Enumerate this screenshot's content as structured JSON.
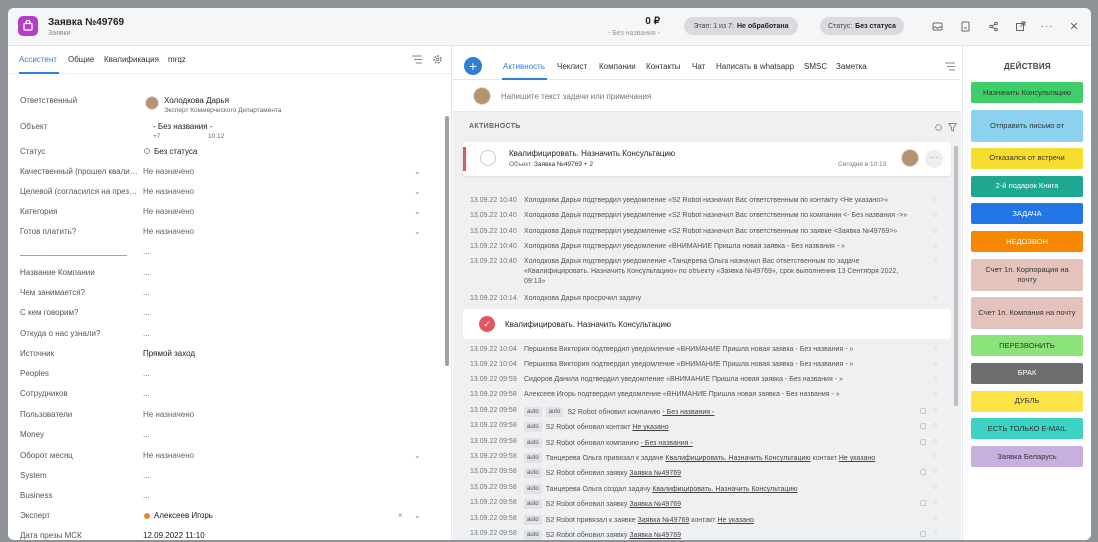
{
  "header": {
    "title": "Заявка  №49769",
    "subtitle": "Заявки",
    "amount": "0 ₽",
    "amount_sub": "- Без названия -",
    "stage_label": "Этап: 1 из 7:",
    "stage_value": "Не обработана",
    "status_label": "Статус:",
    "status_value": "Без статуса"
  },
  "left_tabs": [
    "Ассистент",
    "Общие",
    "Квалификация",
    "mrqz"
  ],
  "fields": [
    {
      "label": "Ответственный",
      "value": "Холодкова Дарья",
      "sub": "Эксперт Коммерческого Департамента"
    },
    {
      "label": "Объект",
      "value": "- Без названия -",
      "sub": "+7",
      "sub2": "10:12"
    },
    {
      "label": "Статус",
      "value": "Без статуса"
    },
    {
      "label": "Качественный (прошел квалификацию)",
      "value": "Не назначено"
    },
    {
      "label": "Целевой (согласился на презентацию)",
      "value": "Не назначено"
    },
    {
      "label": "Категория",
      "value": "Не назначено"
    },
    {
      "label": "Готов платить?",
      "value": "Не назначено"
    },
    {
      "label": "________________________",
      "value": "..."
    },
    {
      "label": "Название Компании",
      "value": "..."
    },
    {
      "label": "Чем занимается?",
      "value": "..."
    },
    {
      "label": "С кем говорим?",
      "value": "..."
    },
    {
      "label": "Откуда о нас узнали?",
      "value": "..."
    },
    {
      "label": "Источник",
      "value": "Прямой заход"
    },
    {
      "label": "Peoples",
      "value": "..."
    },
    {
      "label": "Сотрудников",
      "value": "..."
    },
    {
      "label": "Пользователи",
      "value": "Не назначено"
    },
    {
      "label": "Money",
      "value": "..."
    },
    {
      "label": "Оборот месяц",
      "value": "Не назначено"
    },
    {
      "label": "System",
      "value": "..."
    },
    {
      "label": "Business",
      "value": "..."
    },
    {
      "label": "Эксперт",
      "value": "Алексеев Игорь"
    },
    {
      "label": "Дата презы МСК",
      "value": "12.09.2022 11:10"
    }
  ],
  "mid_tabs": [
    "Активность",
    "Чеклист",
    "Компании",
    "Контакты",
    "Чат",
    "Написать в whatsapp",
    "SMSC",
    "Заметка"
  ],
  "compose_placeholder": "Напишите текст задачи или примечания",
  "activity_title": "АКТИВНОСТЬ",
  "task_card": {
    "title": "Квалифицировать. Назначить Консультацию",
    "object_label": "Объект:",
    "object_value": "Заявка  №49769 + 2",
    "time": "Сегодня в 10:13"
  },
  "timeline_a": [
    {
      "date": "13.09.22 10:40",
      "text": "Холодкова Дарья подтвердил уведомление «S2 Robot назначил Вас ответственным по контакту <Не указано>»"
    },
    {
      "date": "13.09.22 10:40",
      "text": "Холодкова Дарья подтвердил уведомление «S2 Robot назначил Вас ответственным по компании <- Без названия ->»"
    },
    {
      "date": "13.09.22 10:40",
      "text": "Холодкова Дарья подтвердил уведомление «S2 Robot назначил Вас ответственным по заявке <Заявка  №49769>»"
    },
    {
      "date": "13.09.22 10:40",
      "text": "Холодкова Дарья подтвердил уведомление «ВНИМАНИЕ Пришла новая заявка - Без названия - »"
    },
    {
      "date": "13.09.22 10:40",
      "text": "Холодкова Дарья подтвердил уведомление «Танцерева Ольга назначил Вас ответственным по задаче",
      "text2": "«Квалифицировать. Назначить Консультацию» по объекту «Заявка  №49769», срок выполнения 13 Сентября 2022,",
      "text3": "09:13»"
    },
    {
      "date": "13.09.22 10:14",
      "text": "Холодкова Дарья просрочил задачу"
    }
  ],
  "done_task": "Квалифицировать. Назначить Консультацию",
  "timeline_b": [
    {
      "date": "13.09.22 10:04",
      "text": "Першкова Виктория подтвердил уведомление «ВНИМАНИЕ Пришла новая заявка - Без названия - »"
    },
    {
      "date": "13.09.22 10:04",
      "text": "Першкова Виктория подтвердил уведомление «ВНИМАНИЕ Пришла новая заявка - Без названия - »"
    },
    {
      "date": "13.09.22 09:59",
      "text": "Сидоров Данила подтвердил уведомление «ВНИМАНИЕ Пришла новая заявка - Без названия - »"
    },
    {
      "date": "13.09.22 09:58",
      "text": "Алексеев Игорь подтвердил уведомление «ВНИМАНИЕ Пришла новая заявка - Без названия - »"
    }
  ],
  "timeline_c": [
    {
      "date": "13.09.22 09:58",
      "tags": [
        "auto",
        "auto"
      ],
      "text": "S2 Robot обновил компанию",
      "link": "- Без названия -"
    },
    {
      "date": "13.09.22 09:58",
      "tags": [
        "auto"
      ],
      "text": "S2 Robot обновил контакт",
      "link": "Не указано"
    },
    {
      "date": "13.09.22 09:58",
      "tags": [
        "auto"
      ],
      "text": "S2 Robot обновил компанию",
      "link": "- Без названия -"
    },
    {
      "date": "13.09.22 09:58",
      "tags": [
        "auto"
      ],
      "text": "Танцерева Ольга привязал к задаче",
      "link": "Квалифицировать. Назначить Консультацию",
      "text_after": "контакт",
      "link2": "Не указано"
    },
    {
      "date": "13.09.22 09:58",
      "tags": [
        "auto"
      ],
      "text": "S2 Robot обновил заявку",
      "link": "Заявка  №49769"
    },
    {
      "date": "13.09.22 09:58",
      "tags": [
        "auto"
      ],
      "text": "Танцерева Ольга создал задачу",
      "link": "Квалифицировать. Назначить Консультацию"
    },
    {
      "date": "13.09.22 09:58",
      "tags": [
        "auto"
      ],
      "text": "S2 Robot обновил заявку",
      "link": "Заявка  №49769"
    },
    {
      "date": "13.09.22 09:58",
      "tags": [
        "auto"
      ],
      "text": "S2 Robot привязал к заявке",
      "link": "Заявка  №49769",
      "text_after": "контакт",
      "link2": "Не указано"
    },
    {
      "date": "13.09.22 09:58",
      "tags": [
        "auto"
      ],
      "text": "S2 Robot обновил заявку",
      "link": "Заявка  №49769"
    }
  ],
  "actions_title": "ДЕЙСТВИЯ",
  "actions": [
    {
      "label": "Назначить Консультацию",
      "color": "#3fcf6a",
      "tall": false
    },
    {
      "label": "Отправить письмо от",
      "color": "#8cd1ef",
      "tall": true
    },
    {
      "label": "Отказался от встречи",
      "color": "#f7de2e",
      "tall": false
    },
    {
      "label": "2-й подарок Книга",
      "color": "#1ea891",
      "tall": false
    },
    {
      "label": "ЗАДАЧА",
      "color": "#2276e6",
      "tall": false
    },
    {
      "label": "НЕДОЗВОН",
      "color": "#f78600",
      "tall": false
    },
    {
      "label": "Счет 1п. Корпорация на почту",
      "color": "#e5c3bd",
      "tall": true
    },
    {
      "label": "Счет 1п. Компания на почту",
      "color": "#e5c3bd",
      "tall": true
    },
    {
      "label": "ПЕРЕЗВОНИТЬ",
      "color": "#8de37b",
      "tall": false
    },
    {
      "label": "БРАК",
      "color": "#6d6e70",
      "tall": false
    },
    {
      "label": "ДУБЛЬ",
      "color": "#fbe348",
      "tall": false
    },
    {
      "label": "ЕСТЬ ТОЛЬКО E-MAIL",
      "color": "#3dd3c4",
      "tall": false
    },
    {
      "label": "Заявка Беларусь",
      "color": "#c7b0df",
      "tall": false
    }
  ]
}
